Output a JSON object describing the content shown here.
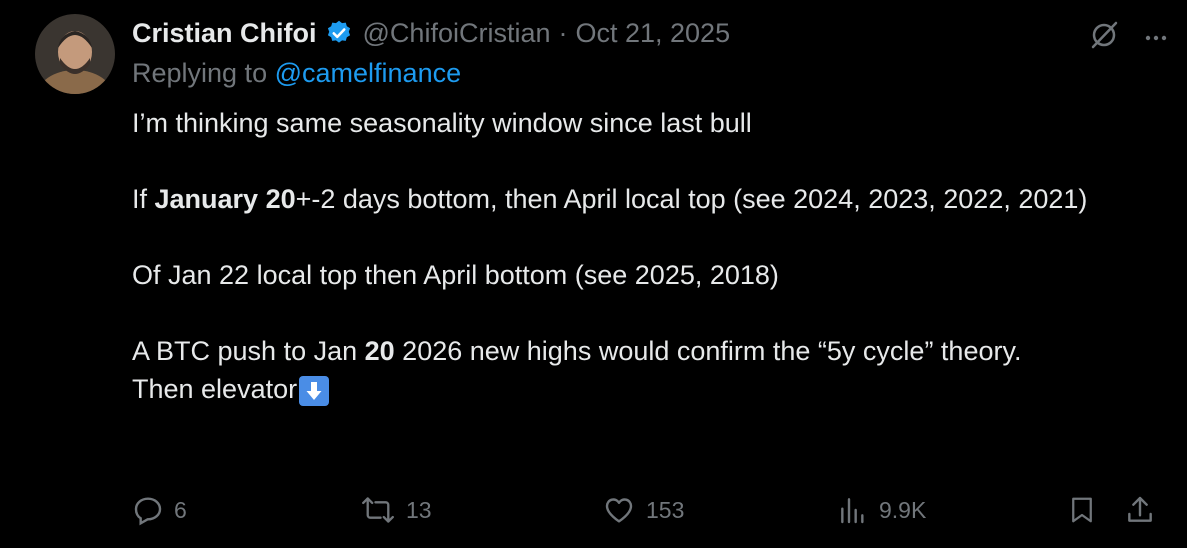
{
  "tweet": {
    "author_name": "Cristian Chifoi",
    "handle": "@ChifoiCristian",
    "date": "Oct 21, 2025",
    "reply_prefix": "Replying to",
    "reply_mention": "@camelfinance",
    "line1": "I’m thinking same seasonality window since last bull",
    "line2_pre": "If ",
    "line2_bold": "January 20",
    "line2_rest": "+-2 days bottom, then April local top (see 2024, 2023, 2022, 2021)",
    "line3": "Of Jan 22 local top then April bottom (see 2025, 2018)",
    "line4_pre": "A BTC push to Jan ",
    "line4_bold": "20",
    "line4_rest": " 2026 new highs would confirm the “5y cycle” theory.",
    "line5": "Then elevator"
  },
  "actions": {
    "replies": "6",
    "reposts": "13",
    "likes": "153",
    "views": "9.9K"
  },
  "colors": {
    "accent": "#1d9bf0",
    "muted": "#71767b",
    "text": "#e7e9ea",
    "background": "#000000"
  },
  "icons": [
    "verified-badge-icon",
    "grok-icon",
    "more-icon",
    "reply-icon",
    "repost-icon",
    "like-icon",
    "views-icon",
    "bookmark-icon",
    "share-icon",
    "down-arrow-emoji-icon"
  ]
}
